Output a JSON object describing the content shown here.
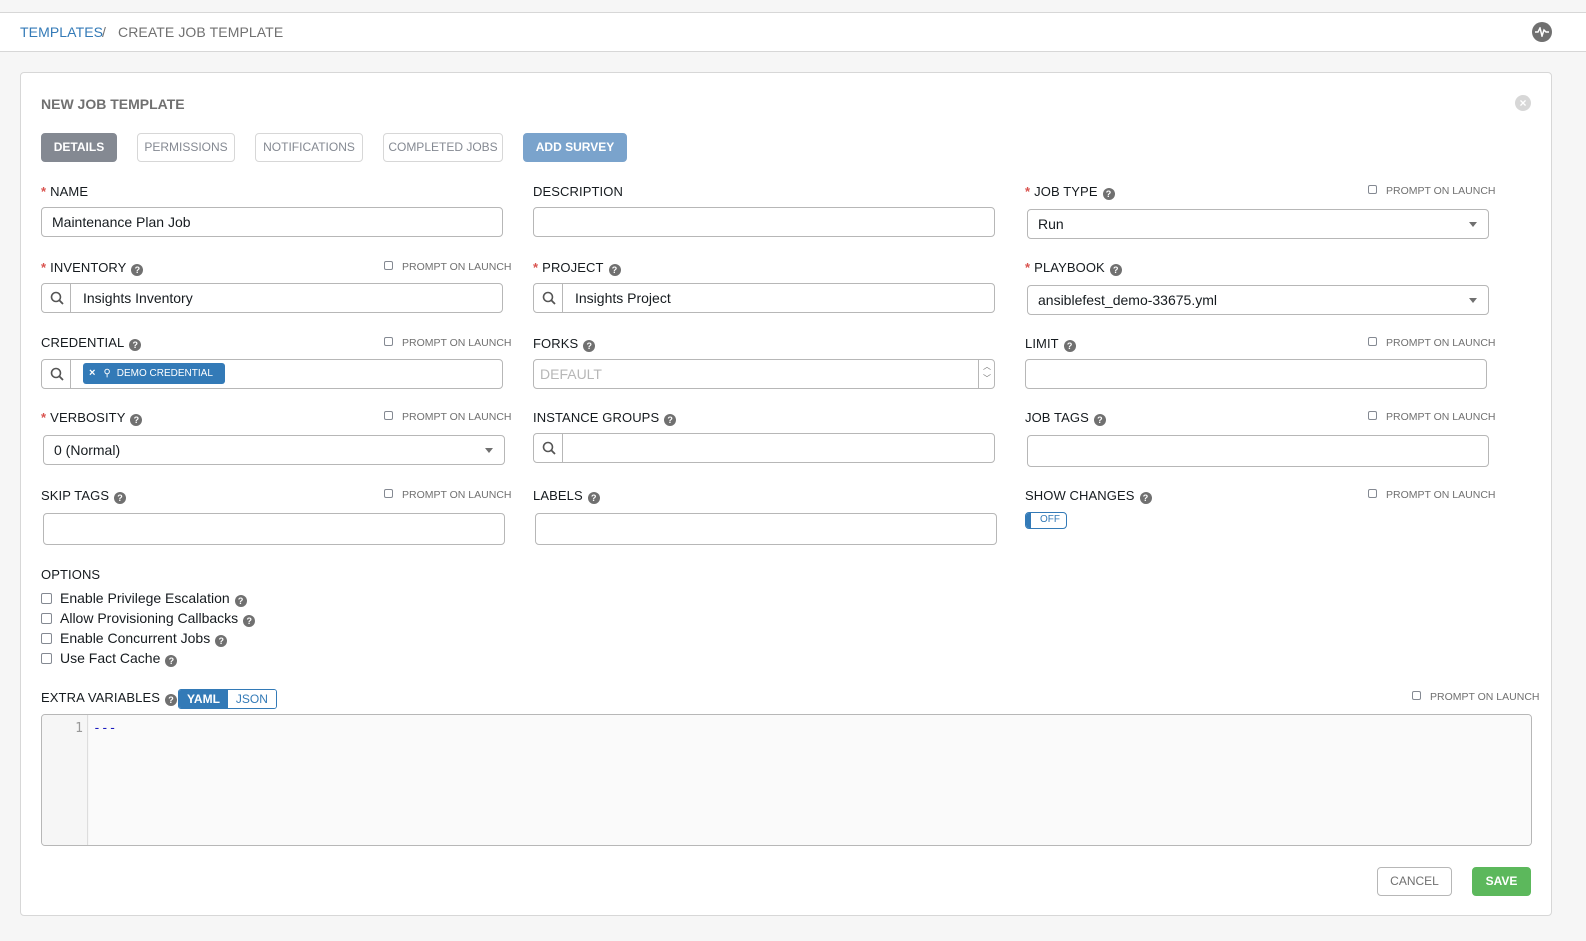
{
  "breadcrumb": {
    "parent": "TEMPLATES",
    "separator": "/",
    "current": "CREATE JOB TEMPLATE"
  },
  "panel": {
    "title": "NEW JOB TEMPLATE"
  },
  "tabs": [
    {
      "label": "DETAILS",
      "state": "active"
    },
    {
      "label": "PERMISSIONS",
      "state": "inactive"
    },
    {
      "label": "NOTIFICATIONS",
      "state": "inactive"
    },
    {
      "label": "COMPLETED JOBS",
      "state": "inactive"
    },
    {
      "label": "ADD SURVEY",
      "state": "action"
    }
  ],
  "prompt_label": "PROMPT ON LAUNCH",
  "fields": {
    "name": {
      "label": "NAME",
      "value": "Maintenance Plan Job"
    },
    "description": {
      "label": "DESCRIPTION",
      "value": ""
    },
    "job_type": {
      "label": "JOB TYPE",
      "value": "Run"
    },
    "inventory": {
      "label": "INVENTORY",
      "value": "Insights Inventory"
    },
    "project": {
      "label": "PROJECT",
      "value": "Insights Project"
    },
    "playbook": {
      "label": "PLAYBOOK",
      "value": "ansiblefest_demo-33675.yml"
    },
    "credential": {
      "label": "CREDENTIAL",
      "chip": "DEMO CREDENTIAL"
    },
    "forks": {
      "label": "FORKS",
      "placeholder": "DEFAULT"
    },
    "limit": {
      "label": "LIMIT",
      "value": ""
    },
    "verbosity": {
      "label": "VERBOSITY",
      "value": "0 (Normal)"
    },
    "instance_groups": {
      "label": "INSTANCE GROUPS",
      "value": ""
    },
    "job_tags": {
      "label": "JOB TAGS",
      "value": ""
    },
    "skip_tags": {
      "label": "SKIP TAGS",
      "value": ""
    },
    "labels": {
      "label": "LABELS",
      "value": ""
    },
    "show_changes": {
      "label": "SHOW CHANGES",
      "toggle": "OFF"
    }
  },
  "options": {
    "label": "OPTIONS",
    "items": [
      "Enable Privilege Escalation",
      "Allow Provisioning Callbacks",
      "Enable Concurrent Jobs",
      "Use Fact Cache"
    ]
  },
  "extra_vars": {
    "label": "EXTRA VARIABLES",
    "modes": [
      "YAML",
      "JSON"
    ],
    "active_mode": "YAML",
    "line_number": "1",
    "content": "---"
  },
  "actions": {
    "cancel": "CANCEL",
    "save": "SAVE"
  },
  "colors": {
    "primary": "#337ab7",
    "success": "#5cb85c",
    "required": "#d9534f",
    "muted": "#848992"
  }
}
